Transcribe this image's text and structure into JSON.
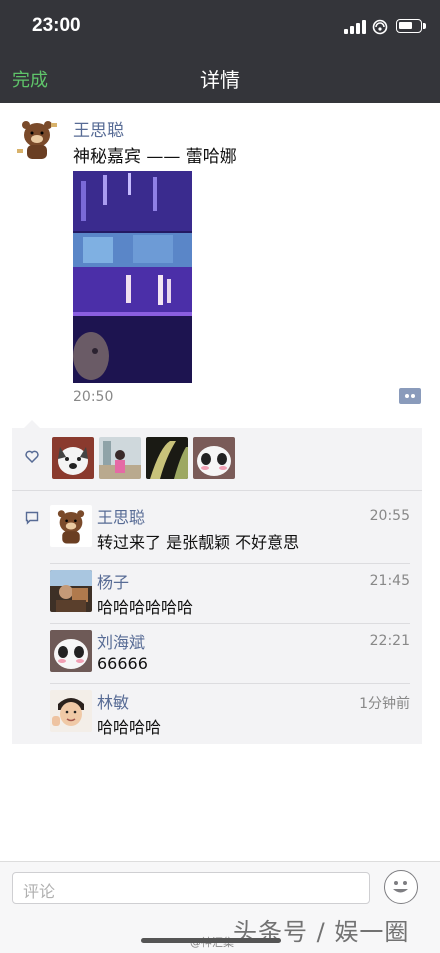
{
  "status_bar": {
    "time": "23:00"
  },
  "nav": {
    "done_label": "完成",
    "title": "详情"
  },
  "post": {
    "author": "王思聪",
    "text": "神秘嘉宾 —— 蕾哈娜",
    "time": "20:50"
  },
  "comments": [
    {
      "name": "王思聪",
      "text": "转过来了 是张靓颖 不好意思",
      "time": "20:55"
    },
    {
      "name": "杨子",
      "text": "哈哈哈哈哈哈",
      "time": "21:45"
    },
    {
      "name": "刘海斌",
      "text": "66666",
      "time": "22:21"
    },
    {
      "name": "林敏",
      "text": "哈哈哈哈",
      "time": "1分钟前"
    }
  ],
  "input": {
    "placeholder": "评论"
  },
  "watermark": {
    "text": "头条号 / 娱一圈",
    "weibo": "@神汇集"
  },
  "colors": {
    "nav_bg": "#34353a",
    "done_green": "#5fc46a",
    "link_blue": "#576b95",
    "panel_bg": "#f3f3f5"
  },
  "icons": [
    "signal-icon",
    "wifi-icon",
    "battery-icon",
    "heart-icon",
    "comment-icon",
    "more-icon",
    "emoji-icon"
  ]
}
